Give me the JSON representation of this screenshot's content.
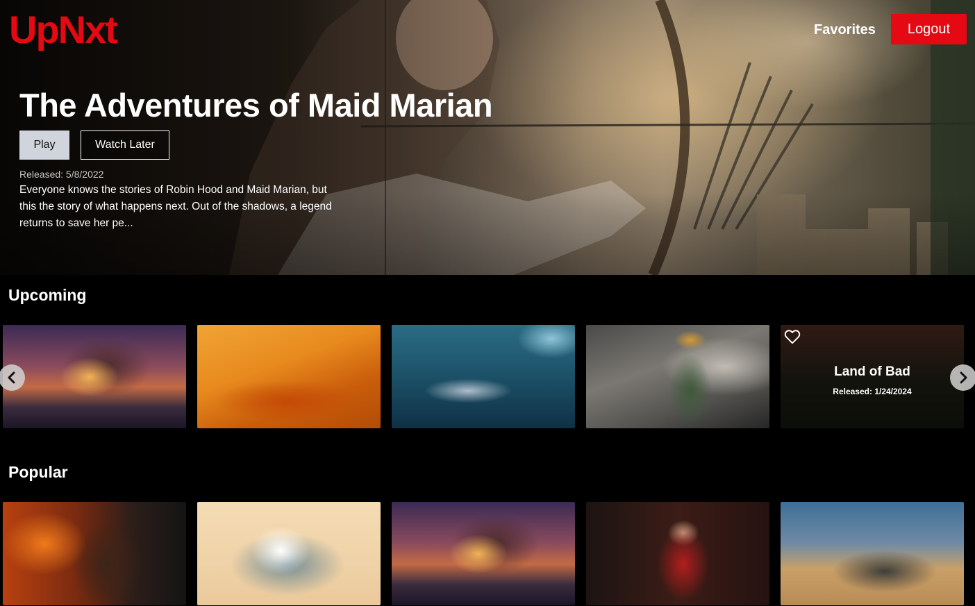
{
  "header": {
    "logo": "UpNxt",
    "favorites_label": "Favorites",
    "logout_label": "Logout"
  },
  "hero": {
    "title": "The Adventures of Maid Marian",
    "play_label": "Play",
    "watch_later_label": "Watch Later",
    "released": "Released: 5/8/2022",
    "description": "Everyone knows the stories of Robin Hood and Maid Marian, but this the story of what happens next. Out of the shadows, a legend returns to save her pe..."
  },
  "upcoming": {
    "title": "Upcoming",
    "hovered_card": {
      "title": "Land of Bad",
      "released": "Released: 1/24/2024"
    }
  },
  "popular": {
    "title": "Popular"
  },
  "icons": {
    "prev": "chevron-left-icon",
    "next": "chevron-right-icon",
    "favorite": "heart-outline-icon"
  },
  "colors": {
    "brand": "#e50914",
    "background": "#000000",
    "play_button": "#d0d4dc"
  }
}
